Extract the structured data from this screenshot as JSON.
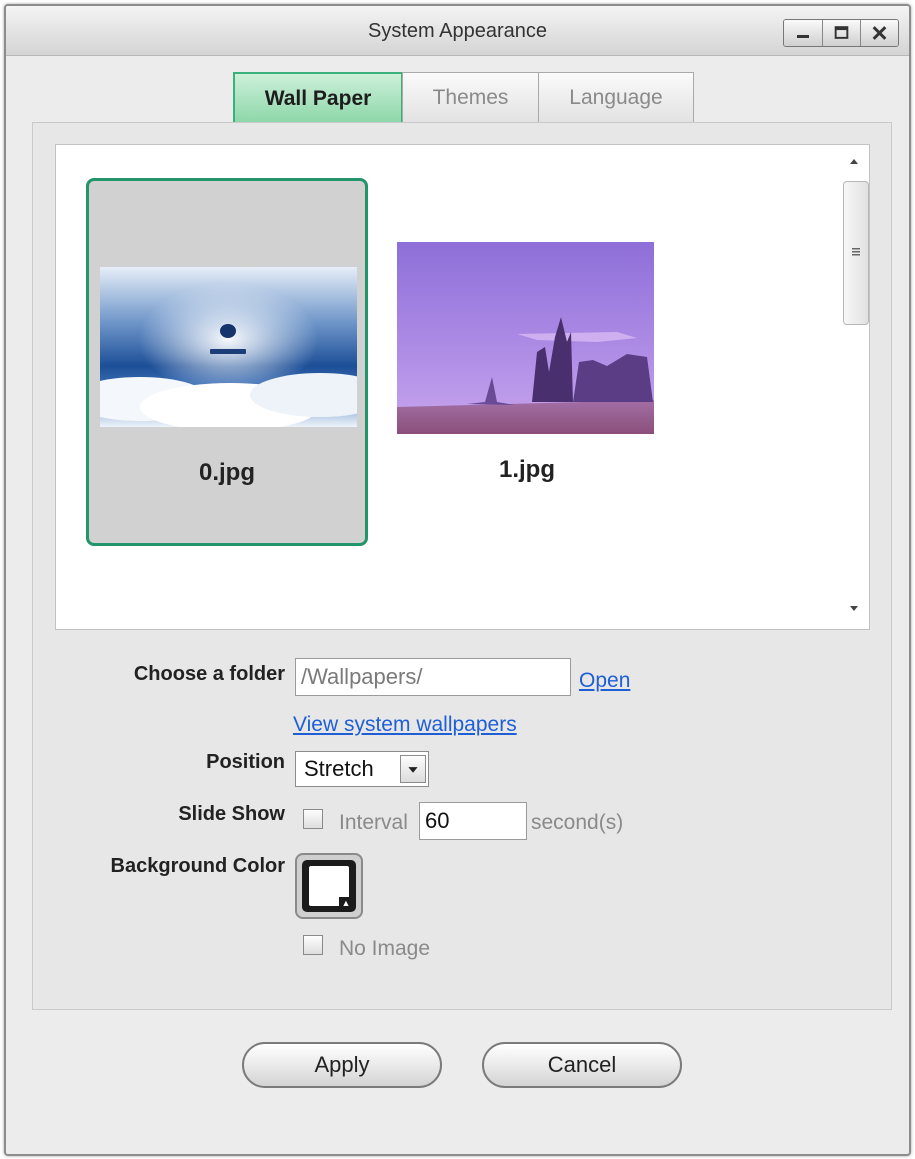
{
  "window": {
    "title": "System Appearance",
    "controls": [
      "minimize-icon",
      "maximize-icon",
      "close-icon"
    ]
  },
  "tabs": [
    {
      "label": "Wall Paper",
      "active": true
    },
    {
      "label": "Themes",
      "active": false
    },
    {
      "label": "Language",
      "active": false
    }
  ],
  "gallery": {
    "items": [
      {
        "name": "0.jpg",
        "selected": true
      },
      {
        "name": "1.jpg",
        "selected": false
      }
    ]
  },
  "form": {
    "folder": {
      "label": "Choose a folder",
      "value": "/Wallpapers/",
      "open_link": "Open",
      "system_link": "View system wallpapers"
    },
    "position": {
      "label": "Position",
      "selected": "Stretch"
    },
    "slideshow": {
      "label": "Slide Show",
      "checked": false,
      "interval_label": "Interval",
      "interval_value": "60",
      "unit": "second(s)"
    },
    "background": {
      "label": "Background Color",
      "color": "#ffffff",
      "no_image_label": "No Image",
      "no_image_checked": false
    }
  },
  "buttons": {
    "apply": "Apply",
    "cancel": "Cancel"
  },
  "colors": {
    "accent_green": "#3ab07a",
    "link_blue": "#1f5fd6"
  }
}
